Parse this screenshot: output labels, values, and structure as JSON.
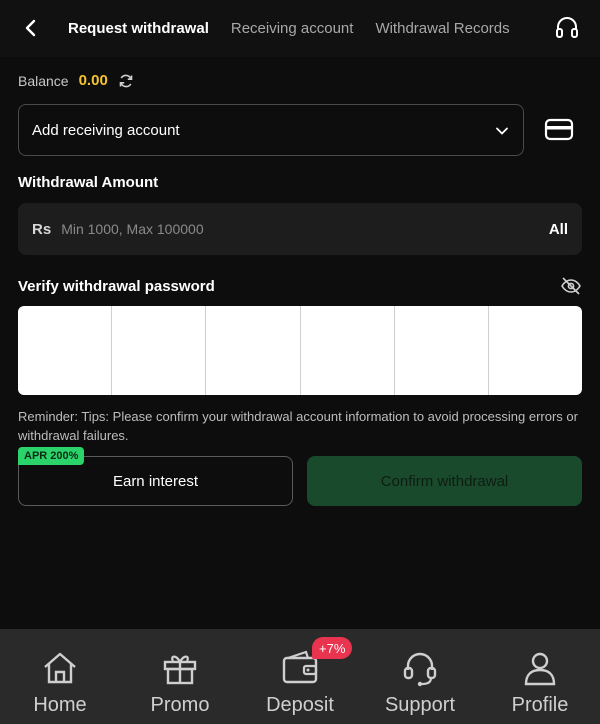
{
  "header": {
    "tabs": [
      {
        "label": "Request withdrawal",
        "active": true
      },
      {
        "label": "Receiving account",
        "active": false
      },
      {
        "label": "Withdrawal Records",
        "active": false
      }
    ]
  },
  "balance": {
    "label": "Balance",
    "value": "0.00"
  },
  "account_select": {
    "label": "Add receiving account"
  },
  "amount": {
    "title": "Withdrawal Amount",
    "currency": "Rs",
    "placeholder": "Min 1000, Max 100000",
    "all_label": "All"
  },
  "password": {
    "title": "Verify withdrawal password",
    "cells": 6
  },
  "reminder": "Reminder: Tips: Please confirm your withdrawal account information to avoid processing errors or withdrawal failures.",
  "earn": {
    "label": "Earn interest",
    "badge": "APR 200%"
  },
  "confirm": {
    "label": "Confirm withdrawal"
  },
  "nav": {
    "items": [
      {
        "label": "Home",
        "icon": "home-icon"
      },
      {
        "label": "Promo",
        "icon": "gift-icon"
      },
      {
        "label": "Deposit",
        "icon": "wallet-icon"
      },
      {
        "label": "Support",
        "icon": "headset-icon"
      },
      {
        "label": "Profile",
        "icon": "user-icon"
      }
    ],
    "deposit_badge": "+7%"
  },
  "colors": {
    "balance_value": "#f5c330",
    "confirm_bg": "#1a4a2c",
    "apr_badge": "#2bd46a",
    "deposit_badge": "#e8344e"
  }
}
